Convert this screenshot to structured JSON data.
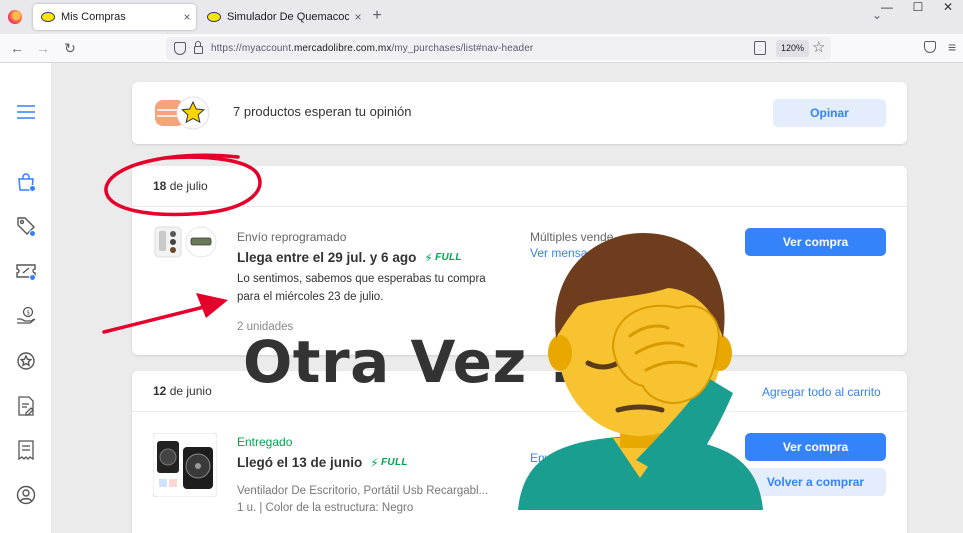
{
  "browser": {
    "tabs": [
      {
        "title": "Mis Compras",
        "close": "×"
      },
      {
        "title": "Simulador De Quemacocos Un",
        "close": "×"
      }
    ],
    "new_tab": "+",
    "list_tabs": "⌄",
    "window_controls": [
      "—",
      "☐",
      "✕"
    ],
    "nav": {
      "back": "←",
      "forward": "→",
      "reload": "↻"
    },
    "url_host": "https://myaccount.",
    "url_domain": "mercadolibre.com.mx",
    "url_path": "/my_purchases/list#nav-header",
    "zoom": "120%",
    "bookmark": "☆",
    "menu": "≡"
  },
  "sidebar": {
    "icons": [
      "menu-icon",
      "shopping-bag-icon",
      "tag-icon",
      "ticket-icon",
      "money-hand-icon",
      "star-circle-icon",
      "document-edit-icon",
      "receipt-icon",
      "user-icon"
    ],
    "accent": "#3483fa"
  },
  "review_card": {
    "text": "7 productos esperan tu opinión",
    "button": "Opinar"
  },
  "order1": {
    "date_day": "18",
    "date_rest": "de julio",
    "status": "Envío reprogramado",
    "status_color": "#666666",
    "headline": "Llega entre el 29 jul. y 6 ago",
    "full_label": "FULL",
    "message_line1": "Lo sentimos, sabemos que esperabas tu compra",
    "message_line2": "para el miércoles 23 de julio.",
    "quantity": "2 unidades",
    "seller": "Múltiples vende",
    "seller_link": "Ver mensa",
    "button": "Ver compra"
  },
  "order2": {
    "date_day": "12",
    "date_rest": "de junio",
    "cart_link": "Agregar todo al carrito",
    "status": "Entregado",
    "status_color": "#00a650",
    "headline": "Llegó el 13 de junio",
    "full_label": "FULL",
    "product": "Ventilador De Escritorio, Portátil Usb Recargabl...",
    "variant": "1 u. | Color de la estructura: Negro",
    "seller_link": "Envia",
    "button_primary": "Ver compra",
    "button_secondary": "Volver a comprar"
  },
  "overlay": {
    "text": "Otra Vez !",
    "emoji": "man-facepalming-emoji"
  },
  "annotation_color": "#e4002b"
}
